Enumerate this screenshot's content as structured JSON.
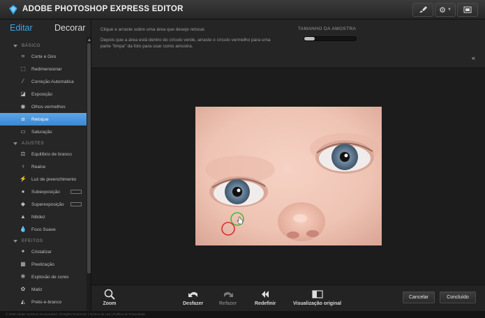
{
  "app": {
    "title": "ADOBE PHOTOSHOP EXPRESS EDITOR"
  },
  "tabs": {
    "editar": "Editar",
    "decorar": "Decorar"
  },
  "sidebar": {
    "sections": [
      {
        "label": "BÁSICO",
        "items": [
          {
            "label": "Corte e Giro",
            "icon": "crop-icon"
          },
          {
            "label": "Redimensionar",
            "icon": "resize-icon"
          },
          {
            "label": "Correção Automática",
            "icon": "wand-icon"
          },
          {
            "label": "Exposição",
            "icon": "exposure-icon"
          },
          {
            "label": "Olhos vermelhos",
            "icon": "eye-icon"
          },
          {
            "label": "Retoque",
            "icon": "bandage-icon",
            "active": true
          },
          {
            "label": "Saturação",
            "icon": "saturation-icon"
          }
        ]
      },
      {
        "label": "AJUSTES",
        "items": [
          {
            "label": "Equilíbrio de branco",
            "icon": "white-balance-icon"
          },
          {
            "label": "Realce",
            "icon": "highlight-icon"
          },
          {
            "label": "Luz de preenchimento",
            "icon": "fill-light-icon"
          },
          {
            "label": "Subexposição",
            "icon": "dodge-icon"
          },
          {
            "label": "Superexposição",
            "icon": "burn-icon"
          },
          {
            "label": "Nitidez",
            "icon": "sharpen-icon"
          },
          {
            "label": "Foco Suave",
            "icon": "soft-focus-icon"
          }
        ]
      },
      {
        "label": "EFEITOS",
        "items": [
          {
            "label": "Cristalizar",
            "icon": "crystallize-icon"
          },
          {
            "label": "Pixelização",
            "icon": "pixelate-icon"
          },
          {
            "label": "Explosão de cores",
            "icon": "pop-color-icon"
          },
          {
            "label": "Matiz",
            "icon": "hue-icon"
          },
          {
            "label": "Preto-e-branco",
            "icon": "bw-icon"
          }
        ]
      }
    ]
  },
  "options": {
    "instruction_1": "Clique e arraste sobre uma área que deseje retocar.",
    "instruction_2": "Depois que a área está dentro do círculo verde, arraste o círculo vermelho para uma parte \"limpa\" da foto para usar como amostra.",
    "sample_label": "TAMANHO DA AMOSTRA",
    "sample_size": 0.2
  },
  "toolbar": {
    "zoom": "Zoom",
    "undo": "Desfazer",
    "redo": "Refazer",
    "reset": "Redefinir",
    "view_original": "Visualização original",
    "cancel": "Cancelar",
    "done": "Concluído"
  },
  "footer": {
    "text": "© 2008 Adobe Systems Incorporated. All Rights Reserved.   |   Termos de Uso   |   Política de Privacidade"
  },
  "colors": {
    "accent": "#3aa6e6",
    "active_item": "#4a97de",
    "retouch_target": "#3fbf3f",
    "retouch_sample": "#d83030"
  }
}
